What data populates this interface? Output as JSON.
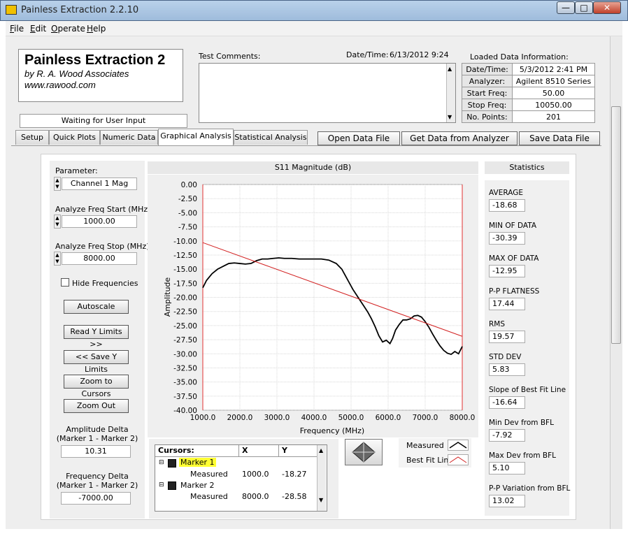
{
  "window": {
    "title": "Painless Extraction 2.2.10",
    "controls": [
      "—",
      "□",
      "✕"
    ]
  },
  "menu": [
    {
      "hot": "F",
      "rest": "ile"
    },
    {
      "hot": "E",
      "rest": "dit"
    },
    {
      "hot": "O",
      "rest": "perate"
    },
    {
      "hot": "H",
      "rest": "elp"
    }
  ],
  "brand": {
    "title": "Painless Extraction 2",
    "line1": "by R. A. Wood Associates",
    "line2": "www.rawood.com"
  },
  "status": "Waiting for User Input",
  "comments": {
    "label": "Test Comments:",
    "datetime_label": "Date/Time:",
    "datetime_value": "6/13/2012  9:24"
  },
  "loaded": {
    "label": "Loaded Data Information:",
    "rows": [
      {
        "k": "Date/Time:",
        "v": "5/3/2012 2:41 PM"
      },
      {
        "k": "Analyzer:",
        "v": "Agilent 8510 Series"
      },
      {
        "k": "Start Freq:",
        "v": "50.00"
      },
      {
        "k": "Stop Freq:",
        "v": "10050.00"
      },
      {
        "k": "No. Points:",
        "v": "201"
      }
    ]
  },
  "tabs": [
    "Setup",
    "Quick Plots",
    "Numeric Data",
    "Graphical Analysis",
    "Statistical Analysis"
  ],
  "active_tab": 3,
  "actions": [
    "Open Data File",
    "Get Data from Analyzer",
    "Save Data File"
  ],
  "controls": {
    "parameter_label": "Parameter:",
    "parameter_value": "Channel 1 Mag",
    "start_label": "Analyze Freq Start (MHz)",
    "start_value": "1000.00",
    "stop_label": "Analyze Freq Stop (MHz)",
    "stop_value": "8000.00",
    "hide_freq": "Hide Frequencies",
    "buttons": [
      "Autoscale",
      "Read Y Limits >>",
      "<< Save Y Limits",
      "Zoom to Cursors",
      "Zoom Out"
    ],
    "amp_delta_label1": "Amplitude Delta",
    "amp_delta_label2": "(Marker 1 - Marker 2)",
    "amp_delta_value": "10.31",
    "freq_delta_label1": "Frequency Delta",
    "freq_delta_label2": "(Marker 1 - Marker 2)",
    "freq_delta_value": "-7000.00"
  },
  "chart_data": {
    "type": "line",
    "title": "S11 Magnitude (dB)",
    "xlabel": "Frequency (MHz)",
    "ylabel": "Amplitude",
    "xlim": [
      1000,
      8000
    ],
    "ylim": [
      -40,
      0
    ],
    "xticks": [
      "1000.0",
      "2000.0",
      "3000.0",
      "4000.0",
      "5000.0",
      "6000.0",
      "7000.0",
      "8000.0"
    ],
    "yticks": [
      "0.00",
      "-2.50",
      "-5.00",
      "-7.50",
      "-10.00",
      "-12.50",
      "-15.00",
      "-17.50",
      "-20.00",
      "-22.50",
      "-25.00",
      "-27.50",
      "-30.00",
      "-32.50",
      "-35.00",
      "-37.50",
      "-40.00"
    ],
    "grid": true,
    "series": [
      {
        "name": "Measured",
        "color": "#000000",
        "x": [
          1000,
          1100,
          1250,
          1400,
          1550,
          1700,
          1850,
          2000,
          2150,
          2300,
          2450,
          2600,
          2750,
          2900,
          3050,
          3200,
          3400,
          3600,
          3800,
          4000,
          4200,
          4400,
          4600,
          4750,
          4850,
          4950,
          5050,
          5150,
          5250,
          5350,
          5450,
          5550,
          5650,
          5750,
          5850,
          5950,
          6050,
          6120,
          6200,
          6300,
          6400,
          6500,
          6600,
          6700,
          6800,
          6900,
          7000,
          7100,
          7200,
          7300,
          7400,
          7500,
          7600,
          7700,
          7800,
          7900,
          8000
        ],
        "y": [
          -18.3,
          -17,
          -15.8,
          -15,
          -14.5,
          -14,
          -13.9,
          -14,
          -14.1,
          -14,
          -13.5,
          -13.2,
          -13.2,
          -13.1,
          -13,
          -13.1,
          -13.1,
          -13.2,
          -13.2,
          -13.2,
          -13.2,
          -13.4,
          -14,
          -15,
          -16.2,
          -17.4,
          -18.6,
          -19.6,
          -20.6,
          -21.6,
          -22.6,
          -23.8,
          -25.2,
          -26.8,
          -27.9,
          -27.6,
          -28.2,
          -27.3,
          -25.8,
          -24.8,
          -24,
          -24,
          -23.8,
          -23.3,
          -23.2,
          -23.5,
          -24.3,
          -25.3,
          -26.5,
          -27.6,
          -28.6,
          -29.4,
          -29.9,
          -30.1,
          -29.6,
          -30,
          -28.7
        ]
      },
      {
        "name": "Best Fit Line",
        "color": "#d22020",
        "x": [
          1000,
          8000
        ],
        "y": [
          -10.3,
          -26.9
        ]
      }
    ],
    "legend": "bottom-right"
  },
  "cursors": {
    "headers": [
      "Cursors:",
      "X",
      "Y"
    ],
    "rows": [
      {
        "marker": "Marker 1",
        "sub": "Measured",
        "x": "1000.0",
        "y": "-18.27"
      },
      {
        "marker": "Marker 2",
        "sub": "Measured",
        "x": "8000.0",
        "y": "-28.58"
      }
    ]
  },
  "legend_items": [
    "Measured",
    "Best Fit Line"
  ],
  "stats": {
    "header": "Statistics",
    "items": [
      {
        "label": "AVERAGE",
        "value": "-18.68"
      },
      {
        "label": "MIN OF DATA",
        "value": "-30.39"
      },
      {
        "label": "MAX OF DATA",
        "value": "-12.95"
      },
      {
        "label": "P-P FLATNESS",
        "value": "17.44"
      },
      {
        "label": "RMS",
        "value": "19.57"
      },
      {
        "label": "STD DEV",
        "value": "5.83"
      },
      {
        "label": "Slope of Best Fit Line",
        "value": "-16.64"
      },
      {
        "label": "Min Dev from BFL",
        "value": "-7.92"
      },
      {
        "label": "Max Dev from BFL",
        "value": "5.10"
      },
      {
        "label": "P-P Variation from BFL",
        "value": "13.02"
      }
    ]
  }
}
